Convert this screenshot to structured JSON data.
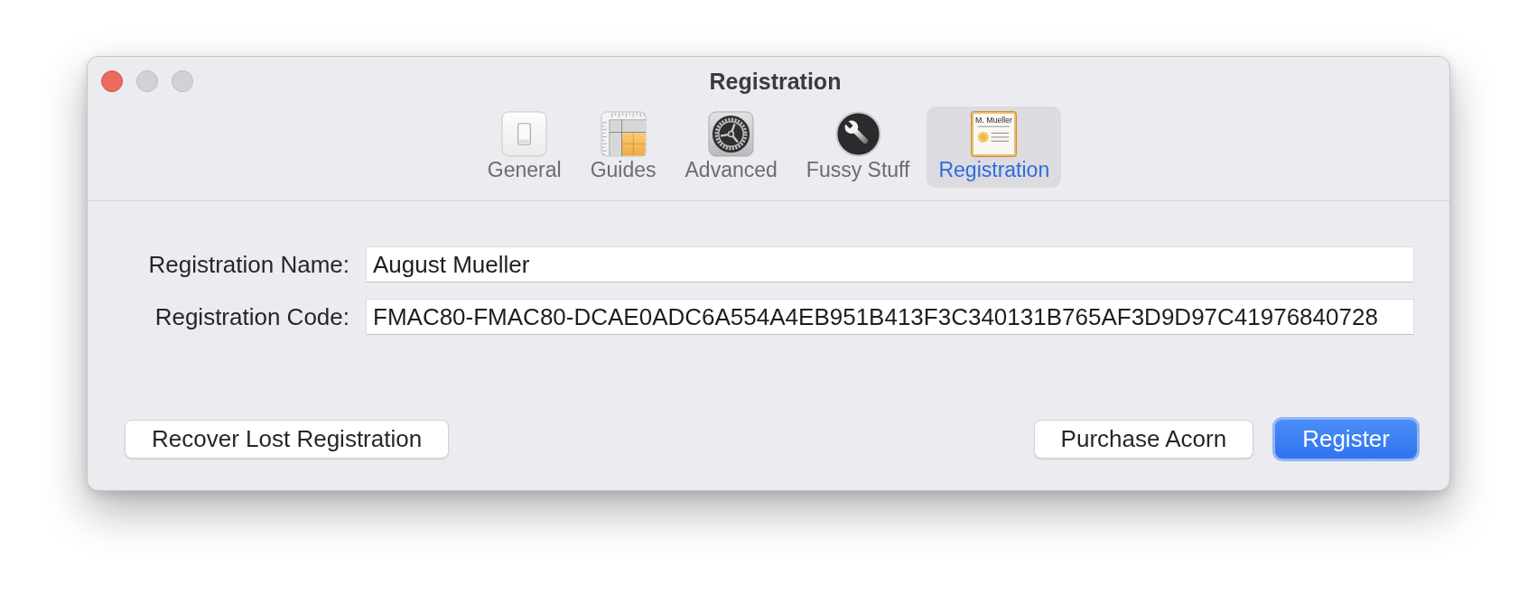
{
  "window": {
    "title": "Registration",
    "controls": [
      {
        "kind": "close",
        "disabled": false
      },
      {
        "kind": "minimize",
        "disabled": true
      },
      {
        "kind": "zoom",
        "disabled": true
      }
    ]
  },
  "tabs": [
    {
      "label": "General",
      "kind": "switch",
      "selected": false
    },
    {
      "label": "Guides",
      "kind": "guides",
      "selected": false
    },
    {
      "label": "Advanced",
      "kind": "gear",
      "selected": false
    },
    {
      "label": "Fussy Stuff",
      "kind": "wrench",
      "selected": false
    },
    {
      "label": "Registration",
      "kind": "certificate",
      "icon_text": "M. Mueller",
      "selected": true
    }
  ],
  "form": {
    "fields": [
      {
        "label": "Registration Name:",
        "value": "August Mueller"
      },
      {
        "label": "Registration Code:",
        "value": "FMAC80-FMAC80-DCAE0ADC6A554A4EB951B413F3C340131B765AF3D9D97C41976840728"
      }
    ]
  },
  "footer": {
    "left_buttons": [
      {
        "label": "Recover Lost Registration",
        "primary": false
      }
    ],
    "right_buttons": [
      {
        "label": "Purchase Acorn",
        "primary": false
      },
      {
        "label": "Register",
        "primary": true
      }
    ]
  }
}
